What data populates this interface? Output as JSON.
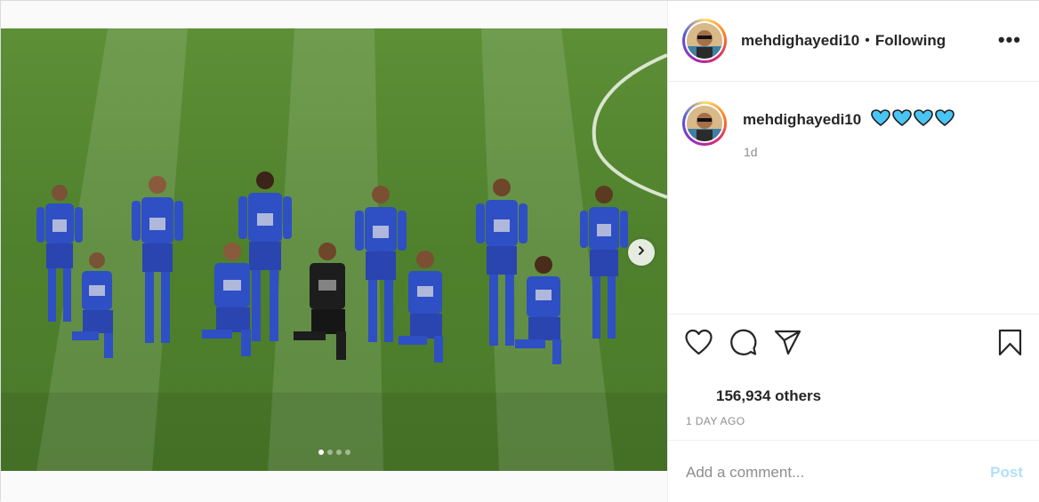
{
  "post": {
    "carousel": {
      "slide_count": 4,
      "active_slide": 1
    },
    "author": {
      "username": "mehdighayedi10",
      "separator": "•",
      "follow_status": "Following"
    },
    "more_icon": "ellipsis-icon",
    "caption": {
      "username": "mehdighayedi10",
      "text": "💙💙💙💙",
      "time": "1d"
    },
    "actions": {
      "icons": [
        "heart-icon",
        "comment-icon",
        "share-icon",
        "bookmark-icon"
      ]
    },
    "likes_text": "156,934 others",
    "date": "1 DAY AGO",
    "comment": {
      "placeholder": "Add a comment...",
      "post_label": "Post"
    }
  },
  "colors": {
    "link_disabled": "#b2dffc",
    "secondary_text": "#8e8e8e",
    "jersey_blue": "#2f4fc4",
    "pitch_green": "#4e7f2e"
  }
}
